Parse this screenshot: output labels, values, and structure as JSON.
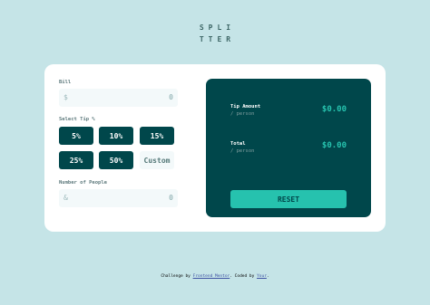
{
  "logo": {
    "line1": "SPLI",
    "line2": "TTER"
  },
  "form": {
    "bill_label": "Bill",
    "bill_prefix": "$",
    "bill_value": "0",
    "tip_label": "Select Tip %",
    "tips": [
      "5%",
      "10%",
      "15%",
      "25%",
      "50%"
    ],
    "custom_label": "Custom",
    "people_label": "Number of People",
    "people_prefix": "&",
    "people_value": "0"
  },
  "result": {
    "tip_amount_label": "Tip Amount",
    "tip_amount_sub": "/ person",
    "tip_amount_value": "$0.00",
    "total_label": "Total",
    "total_sub": "/ person",
    "total_value": "$0.00",
    "reset_label": "RESET"
  },
  "footer": {
    "text1": "Challenge by ",
    "link1": "Frontend Mentor",
    "text2": ". Coded by ",
    "link2": "Your",
    "text3": "."
  },
  "colors": {
    "background": "#c5e4e7",
    "dark_cyan": "#00474b",
    "strong_cyan": "#26c2ae",
    "input_bg": "#f3f9fa"
  }
}
